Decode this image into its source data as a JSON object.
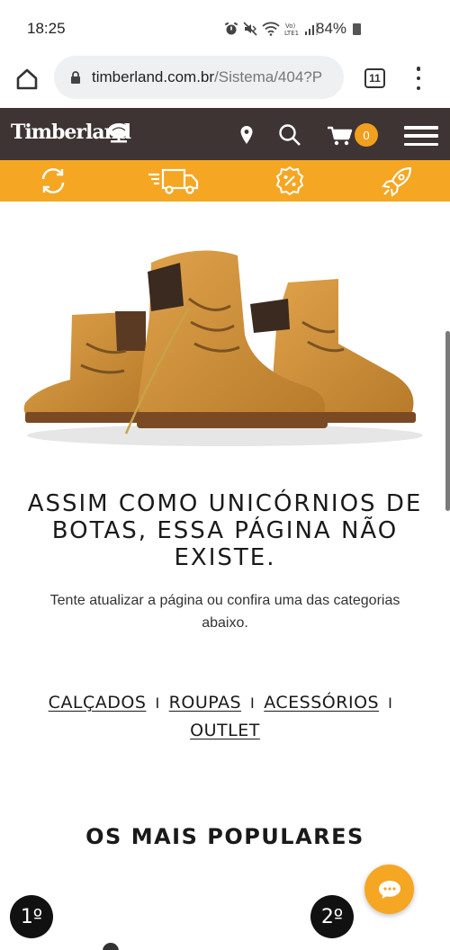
{
  "status_bar": {
    "time": "18:25",
    "battery": "84%",
    "icons": [
      "alarm-icon",
      "mute-icon",
      "wifi-icon",
      "volte-icon",
      "signal-icon",
      "battery-icon"
    ]
  },
  "browser": {
    "url_host": "timberland.com.br",
    "url_path": "/Sistema/404?P",
    "tab_count": "11",
    "icons": [
      "home-icon",
      "lock-icon",
      "overflow-menu-icon"
    ]
  },
  "header": {
    "logo_text": "Timberland",
    "cart_count": "0",
    "icons": [
      "tree-logo-icon",
      "location-pin-icon",
      "search-icon",
      "cart-icon",
      "hamburger-menu-icon"
    ]
  },
  "benefits": {
    "icons": [
      "exchange-icon",
      "delivery-truck-icon",
      "discount-badge-icon",
      "rocket-icon"
    ]
  },
  "message": {
    "title": "ASSIM COMO UNICÓRNIOS DE BOTAS, ESSA PÁGINA NÃO EXISTE.",
    "subtitle": "Tente atualizar a página ou confira uma das categorias abaixo."
  },
  "categories": {
    "items": [
      "CALÇADOS",
      "ROUPAS",
      "ACESSÓRIOS",
      "OUTLET"
    ],
    "separator": "I"
  },
  "popular": {
    "title": "OS MAIS POPULARES",
    "ranks": [
      "1º",
      "2º"
    ]
  },
  "colors": {
    "header_bg": "#3d3433",
    "accent": "#f5a623",
    "boot": "#d99a3e"
  }
}
